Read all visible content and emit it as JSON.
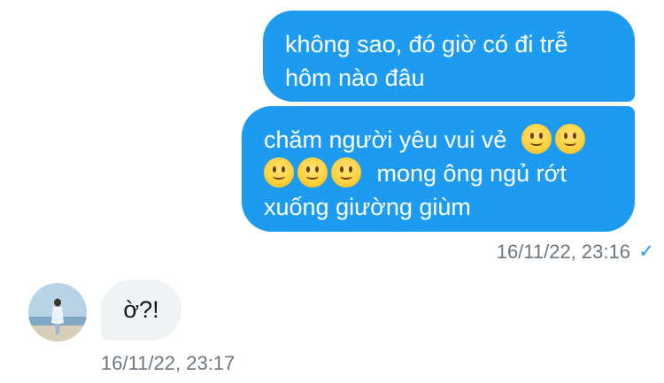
{
  "messages": [
    {
      "direction": "sent",
      "lines": [
        "không sao, đó giờ có đi trễ",
        "hôm nào đâu"
      ]
    },
    {
      "direction": "sent",
      "line1_text": "chăm người yêu vui vẻ",
      "line2_text": "mong ông ngủ rớt",
      "line3_text": "xuống giường giùm",
      "emoji": "slightly-smiling-face",
      "emoji_count": 5,
      "timestamp": "16/11/22, 23:16",
      "status_icon": "checkmark-icon"
    },
    {
      "direction": "received",
      "text": "ờ?!",
      "timestamp": "16/11/22, 23:17"
    }
  ],
  "colors": {
    "sent_bubble": "#1d9bf0",
    "received_bubble": "#eff3f4",
    "timestamp": "#6e767d"
  }
}
